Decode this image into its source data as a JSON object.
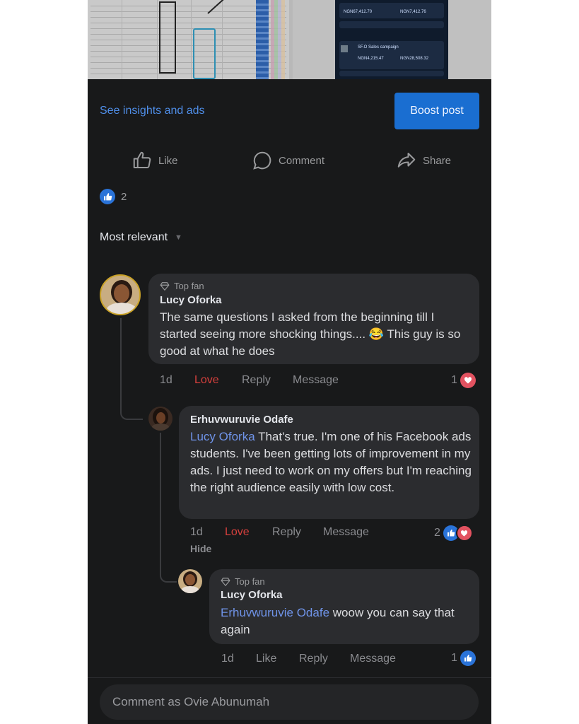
{
  "post": {
    "insights_link": "See insights and ads",
    "boost_button": "Boost post",
    "actions": {
      "like": "Like",
      "comment": "Comment",
      "share": "Share"
    },
    "reaction_count": "2",
    "sort_label": "Most relevant"
  },
  "comments": [
    {
      "badge": "Top fan",
      "author": "Lucy Oforka",
      "text": "The same questions I asked from the beginning till I started seeing more shocking things.... 😂 This guy is so good at what he does",
      "time": "1d",
      "reaction": "Love",
      "reply": "Reply",
      "message": "Message",
      "reaction_count": "1"
    },
    {
      "author": "Erhuvwuruvie Odafe",
      "mention": "Lucy Oforka",
      "text": " That's true. I'm one of his Facebook ads students. I've been getting lots of improvement in my ads. I just need to work on my offers but I'm reaching the right audience easily with low cost.",
      "time": "1d",
      "reaction": "Love",
      "reply": "Reply",
      "message": "Message",
      "reaction_count": "2",
      "hide": "Hide"
    },
    {
      "badge": "Top fan",
      "author": "Lucy Oforka",
      "mention": "Erhuvwuruvie Odafe",
      "text": " woow you can say that again",
      "time": "1d",
      "reaction": "Like",
      "reply": "Reply",
      "message": "Message",
      "reaction_count": "1"
    }
  ],
  "preview": {
    "amounts": [
      "NGN67,412.70",
      "NGN7,412.76",
      "NGN4,215.47",
      "NGN28,508.32"
    ],
    "campaign": "SF.O Sales campaign"
  },
  "composer": {
    "placeholder": "Comment as Ovie Abunumah"
  },
  "colors": {
    "accent": "#1a6ed1",
    "love": "#d6403d",
    "mention": "#6f93e8",
    "background": "#18191a"
  }
}
